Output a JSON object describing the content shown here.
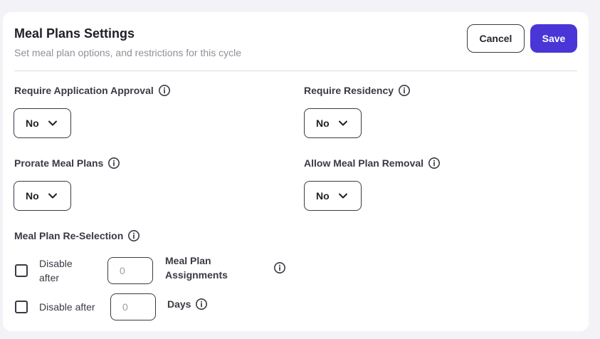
{
  "header": {
    "title": "Meal Plans Settings",
    "subtitle": "Set meal plan options, and restrictions for this cycle",
    "cancel_label": "Cancel",
    "save_label": "Save"
  },
  "fields": {
    "require_application_approval": {
      "label": "Require Application Approval",
      "value": "No"
    },
    "require_residency": {
      "label": "Require Residency",
      "value": "No"
    },
    "prorate_meal_plans": {
      "label": "Prorate Meal Plans",
      "value": "No"
    },
    "allow_meal_plan_removal": {
      "label": "Allow Meal Plan Removal",
      "value": "No"
    }
  },
  "reselection": {
    "label": "Meal Plan Re-Selection",
    "rule1": {
      "label_line1": "Disable",
      "label_line2": "after",
      "placeholder": "0",
      "unit_line1": "Meal Plan",
      "unit_line2": "Assignments",
      "checked": false
    },
    "rule2": {
      "label": "Disable after",
      "placeholder": "0",
      "unit": "Days",
      "checked": false
    }
  },
  "icons": {
    "info": "info-circle-icon",
    "chevron": "chevron-down-icon"
  },
  "colors": {
    "primary": "#4a35d6",
    "border": "#3a3a44",
    "muted_text": "#8f8f99",
    "page_bg": "#f3f3f7"
  }
}
